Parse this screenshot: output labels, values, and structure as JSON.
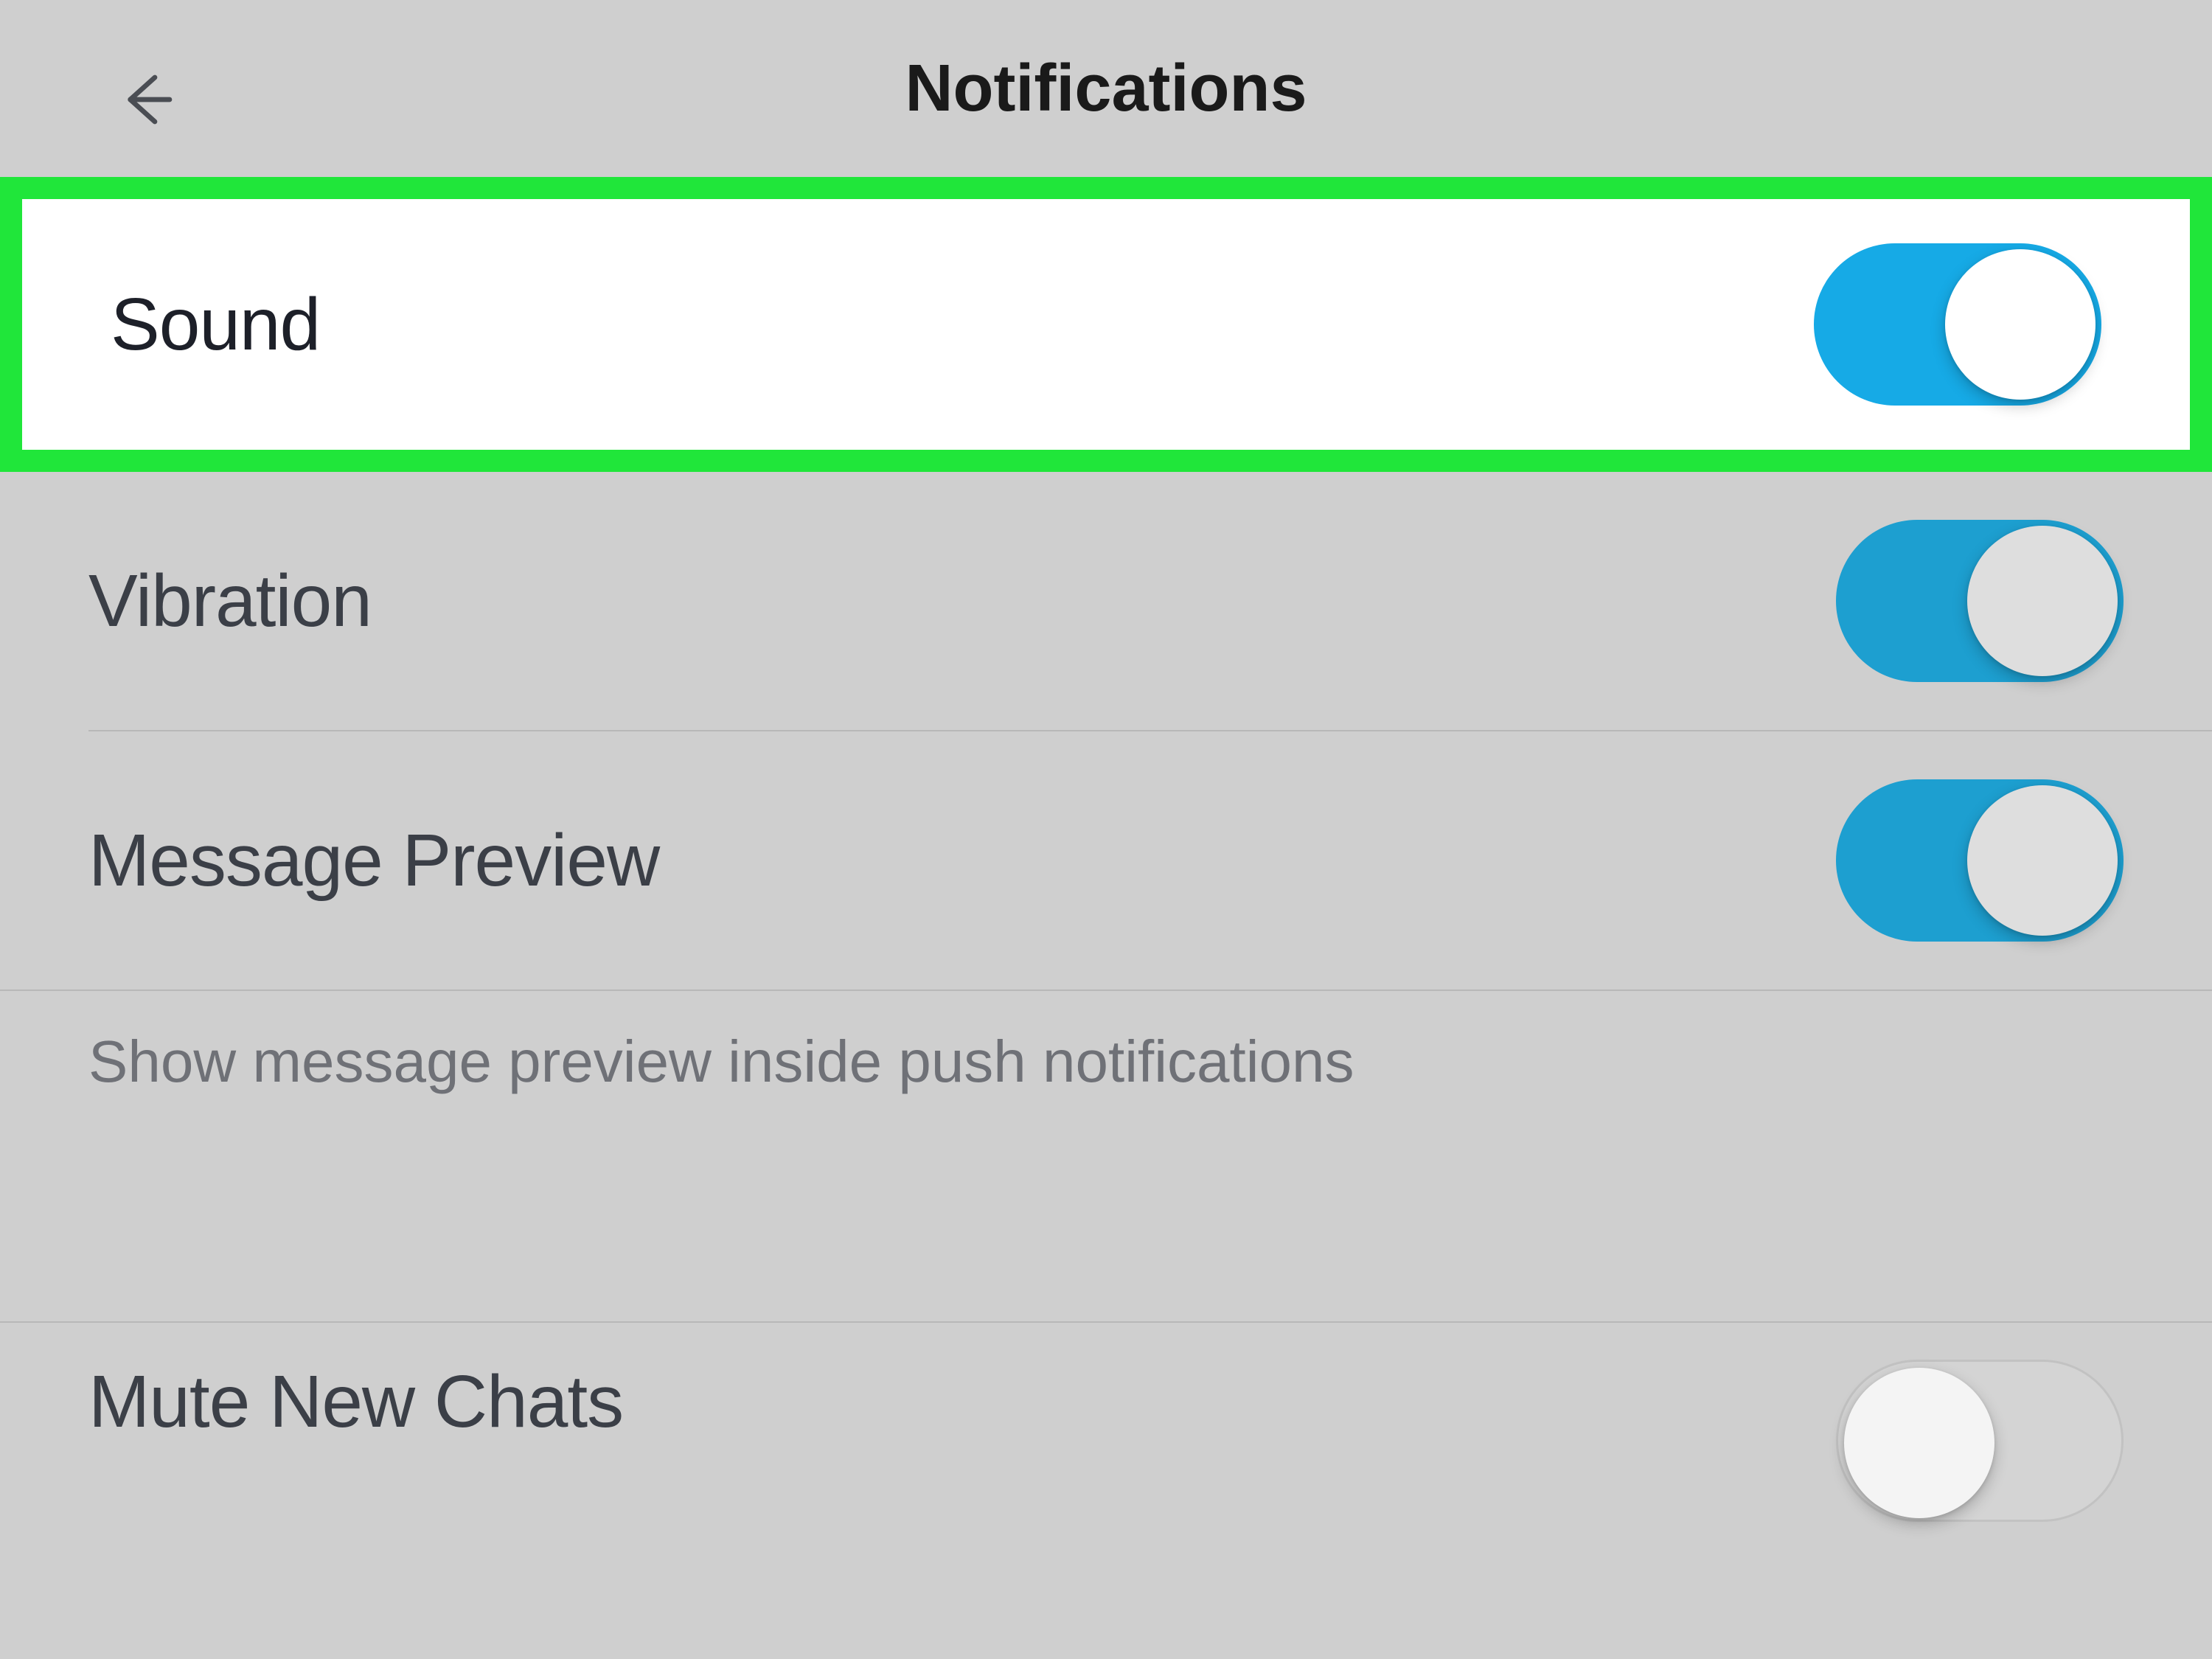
{
  "header": {
    "title": "Notifications"
  },
  "settings": {
    "sound": {
      "label": "Sound",
      "on": true
    },
    "vibration": {
      "label": "Vibration",
      "on": true
    },
    "preview": {
      "label": "Message Preview",
      "on": true
    },
    "preview_caption": "Show message preview inside push notifications",
    "mute_new": {
      "label": "Mute New Chats",
      "on": false
    }
  },
  "highlight_row": "sound",
  "colors": {
    "highlight": "#20e63a",
    "toggle_on": "#16aae6"
  }
}
